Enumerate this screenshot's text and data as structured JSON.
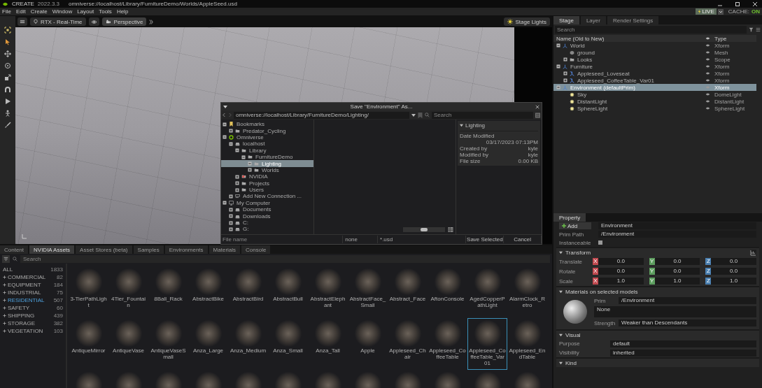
{
  "title_bar": {
    "app": "CREATE",
    "version": "2022.3.3",
    "path": "omniverse://localhost/Library/FurnitureDemo/Worlds/AppleSeed.usd"
  },
  "menu_bar": {
    "items": [
      "File",
      "Edit",
      "Create",
      "Window",
      "Layout",
      "Tools",
      "Help"
    ],
    "live": "LIVE",
    "cache_label": "CACHE:",
    "cache_value": "ON"
  },
  "viewport": {
    "render_mode": "RTX - Real-Time",
    "camera": "Perspective",
    "lights": "Stage Lights"
  },
  "content_browser": {
    "tabs": [
      {
        "label": "Content",
        "selected": false
      },
      {
        "label": "NVIDIA Assets",
        "selected": true
      },
      {
        "label": "Asset Stores (beta)",
        "selected": false
      },
      {
        "label": "Samples",
        "selected": false
      },
      {
        "label": "Environments",
        "selected": false
      },
      {
        "label": "Materials",
        "selected": false
      },
      {
        "label": "Console",
        "selected": false
      }
    ],
    "search": {
      "placeholder": "Search"
    },
    "categories": [
      {
        "label": "ALL",
        "count": "1833",
        "selected": false
      },
      {
        "label": "COMMERCIAL",
        "count": "82",
        "selected": false,
        "expanded": false
      },
      {
        "label": "EQUIPMENT",
        "count": "184",
        "selected": false,
        "expanded": false
      },
      {
        "label": "INDUSTRIAL",
        "count": "75",
        "selected": false,
        "expanded": false
      },
      {
        "label": "RESIDENTIAL",
        "count": "507",
        "selected": true,
        "expanded": false
      },
      {
        "label": "SAFETY",
        "count": "60",
        "selected": false,
        "expanded": false
      },
      {
        "label": "SHIPPING",
        "count": "439",
        "selected": false,
        "expanded": false
      },
      {
        "label": "STORAGE",
        "count": "382",
        "selected": false,
        "expanded": false
      },
      {
        "label": "VEGETATION",
        "count": "103",
        "selected": false,
        "expanded": false
      }
    ],
    "assets": [
      {
        "name": "3-TierPathLight",
        "selected": false
      },
      {
        "name": "4Tier_Fountain",
        "selected": false
      },
      {
        "name": "8Ball_Rack",
        "selected": false
      },
      {
        "name": "AbstractBike",
        "selected": false
      },
      {
        "name": "AbstractBird",
        "selected": false
      },
      {
        "name": "AbstractBull",
        "selected": false
      },
      {
        "name": "AbstractElephant",
        "selected": false
      },
      {
        "name": "AbstractFace_Small",
        "selected": false
      },
      {
        "name": "Abstract_Face",
        "selected": false
      },
      {
        "name": "AftonConsole",
        "selected": false
      },
      {
        "name": "AgedCopperPathLight",
        "selected": false
      },
      {
        "name": "AlarmClock_Retro",
        "selected": false
      },
      {
        "name": "AntiqueMirror",
        "selected": false
      },
      {
        "name": "AntiqueVase",
        "selected": false
      },
      {
        "name": "AntiqueVaseSmall",
        "selected": false
      },
      {
        "name": "Anza_Large",
        "selected": false
      },
      {
        "name": "Anza_Medium",
        "selected": false
      },
      {
        "name": "Anza_Small",
        "selected": false
      },
      {
        "name": "Anza_Tall",
        "selected": false
      },
      {
        "name": "Apple",
        "selected": false
      },
      {
        "name": "Appleseed_Chair",
        "selected": false
      },
      {
        "name": "Appleseed_CoffeeTable",
        "selected": false
      },
      {
        "name": "Appleseed_CoffeeTable_Var01",
        "selected": true
      },
      {
        "name": "Appleseed_EndTable",
        "selected": false
      },
      {
        "selected": false
      },
      {
        "selected": false
      },
      {
        "selected": false
      },
      {
        "selected": false
      },
      {
        "selected": false
      },
      {
        "selected": false
      },
      {
        "selected": false
      },
      {
        "selected": false
      },
      {
        "selected": false
      },
      {
        "selected": false
      },
      {
        "selected": false
      },
      {
        "selected": false
      }
    ]
  },
  "stage": {
    "tabs": [
      {
        "label": "Stage",
        "selected": true
      },
      {
        "label": "Layer",
        "selected": false
      },
      {
        "label": "Render Settings",
        "selected": false
      }
    ],
    "search": {
      "placeholder": "Search"
    },
    "columns": [
      "Name (Old to New)",
      "Type"
    ],
    "tree": [
      {
        "name": "World",
        "type": "Xform",
        "kind": "xform",
        "expanded": true,
        "selected": false,
        "children": [
          {
            "name": "ground",
            "type": "Mesh",
            "kind": "mesh",
            "selected": false
          },
          {
            "name": "Looks",
            "type": "Scope",
            "kind": "folder",
            "expanded": false,
            "selected": false
          }
        ]
      },
      {
        "name": "Furniture",
        "type": "Xform",
        "kind": "xform",
        "expanded": true,
        "selected": false,
        "children": [
          {
            "name": "Appleseed_Loveseat",
            "type": "Xform",
            "kind": "reference",
            "expanded": false,
            "selected": false
          },
          {
            "name": "Appleseed_CoffeeTable_Var01",
            "type": "Xform",
            "kind": "reference",
            "expanded": false,
            "selected": false
          }
        ]
      },
      {
        "name": "Environment (defaultPrim)",
        "type": "Xform",
        "kind": "xform",
        "expanded": true,
        "selected": true,
        "children": [
          {
            "name": "Sky",
            "type": "DomeLight",
            "kind": "light",
            "selected": false
          },
          {
            "name": "DistantLight",
            "type": "DistantLight",
            "kind": "light",
            "selected": false
          },
          {
            "name": "SphereLight",
            "type": "SphereLight",
            "kind": "light",
            "selected": false
          }
        ]
      }
    ]
  },
  "property": {
    "tab": "Property",
    "add_button": "Add",
    "name_value": "Environment",
    "prim_path": {
      "label": "Prim Path",
      "value": "/Environment"
    },
    "instanceable": {
      "label": "Instanceable",
      "checked": false
    },
    "sections": [
      {
        "title": "Transform",
        "kind": "transform",
        "expanded": true,
        "rows": [
          {
            "label": "Translate",
            "values": [
              {
                "axis": "X",
                "color": "#c0494f",
                "value": "0.0"
              },
              {
                "axis": "Y",
                "color": "#5d9e5f",
                "value": "0.0"
              },
              {
                "axis": "Z",
                "color": "#4a7fb0",
                "value": "0.0"
              }
            ]
          },
          {
            "label": "Rotate",
            "values": [
              {
                "axis": "X",
                "color": "#c0494f",
                "value": "0.0"
              },
              {
                "axis": "Y",
                "color": "#5d9e5f",
                "value": "0.0"
              },
              {
                "axis": "Z",
                "color": "#4a7fb0",
                "value": "0.0"
              }
            ]
          },
          {
            "label": "Scale",
            "values": [
              {
                "axis": "X",
                "color": "#c0494f",
                "value": "1.0"
              },
              {
                "axis": "Y",
                "color": "#5d9e5f",
                "value": "1.0"
              },
              {
                "axis": "Z",
                "color": "#4a7fb0",
                "value": "1.0"
              }
            ]
          }
        ]
      },
      {
        "title": "Materials on selected models",
        "kind": "material",
        "expanded": true,
        "prim_label": "Prim",
        "prim_value": "/Environment",
        "material": "None",
        "strength_label": "Strength",
        "strength_value": "Weaker than Descendants"
      },
      {
        "title": "Visual",
        "kind": "fields",
        "expanded": true,
        "fields": [
          {
            "label": "Purpose",
            "value": "default"
          },
          {
            "label": "Visibility",
            "value": "inherited"
          }
        ]
      },
      {
        "title": "Kind",
        "kind": "fields",
        "expanded": true
      }
    ]
  },
  "save_dialog": {
    "title": "Save \"Environment\" As...",
    "path": "omniverse://localhost/Library/FurnitureDemo/Lighting/",
    "search": {
      "placeholder": "Search"
    },
    "tree": [
      {
        "name": "Bookmarks",
        "kind": "bookmark",
        "expanded": true,
        "selected": false,
        "children": [
          {
            "name": "Predator_Cycling",
            "kind": "folder",
            "expanded": false,
            "selected": false
          }
        ]
      },
      {
        "name": "Omniverse",
        "kind": "omniverse",
        "expanded": true,
        "selected": false,
        "children": [
          {
            "name": "localhost",
            "kind": "server",
            "expanded": true,
            "selected": false,
            "children": [
              {
                "name": "Library",
                "kind": "folder",
                "expanded": true,
                "selected": false,
                "children": [
                  {
                    "name": "FurnitureDemo",
                    "kind": "folder",
                    "expanded": true,
                    "selected": false,
                    "children": [
                      {
                        "name": "Lighting",
                        "kind": "folder",
                        "expanded": true,
                        "selected": true
                      },
                      {
                        "name": "Worlds",
                        "kind": "folder",
                        "expanded": false,
                        "selected": false
                      }
                    ]
                  }
                ]
              },
              {
                "name": "NVIDIA",
                "kind": "nvidia",
                "expanded": false,
                "selected": false
              },
              {
                "name": "Projects",
                "kind": "folder",
                "expanded": false,
                "selected": false
              },
              {
                "name": "Users",
                "kind": "folder",
                "expanded": false,
                "selected": false
              }
            ]
          },
          {
            "name": "Add New Connection ...",
            "kind": "connection",
            "expanded": false,
            "selected": false
          }
        ]
      },
      {
        "name": "My Computer",
        "kind": "computer",
        "expanded": true,
        "selected": false,
        "children": [
          {
            "name": "Documents",
            "kind": "server",
            "expanded": false,
            "selected": false
          },
          {
            "name": "Downloads",
            "kind": "server",
            "expanded": false,
            "selected": false
          },
          {
            "name": "C:",
            "kind": "server",
            "expanded": false,
            "selected": false
          },
          {
            "name": "G:",
            "kind": "server",
            "expanded": false,
            "selected": false
          }
        ]
      }
    ],
    "info": {
      "title": "Lighting",
      "rows": [
        {
          "label": "Date Modified",
          "value": "03/17/2023 07:13PM"
        },
        {
          "label": "Created by",
          "value": "kyle"
        },
        {
          "label": "Modified by",
          "value": "kyle"
        },
        {
          "label": "File size",
          "value": "0.00 KB"
        }
      ]
    },
    "zoom_slider": {
      "level": 0.5
    },
    "file_name": {
      "placeholder": "File name"
    },
    "filter_1": "none",
    "filter_2": "*.usd",
    "buttons": [
      "Save Selected",
      "Cancel"
    ]
  }
}
